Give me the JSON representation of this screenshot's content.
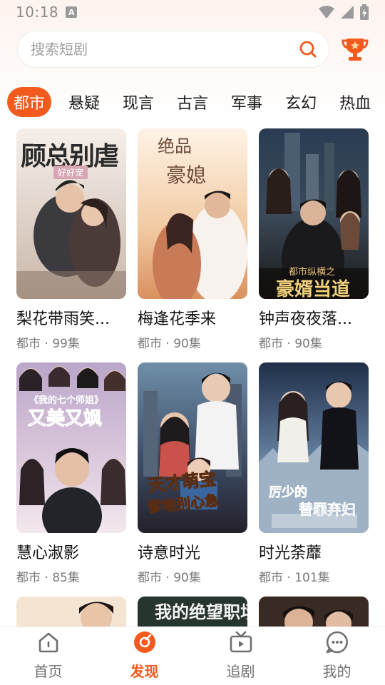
{
  "status_bar": {
    "time": "10:18",
    "badge": "A"
  },
  "search": {
    "placeholder": "搜索短剧"
  },
  "tabs": [
    "都市",
    "悬疑",
    "现言",
    "古言",
    "军事",
    "玄幻",
    "热血"
  ],
  "active_tab": "都市",
  "dramas": [
    {
      "title": "梨花带雨笑...",
      "genre": "都市",
      "episodes": "99集",
      "poster_text": [
        "顾总别虐",
        "好好宠"
      ]
    },
    {
      "title": "梅逢花季来",
      "genre": "都市",
      "episodes": "90集",
      "poster_text": [
        "绝品",
        "豪媳"
      ]
    },
    {
      "title": "钟声夜夜落...",
      "genre": "都市",
      "episodes": "90集",
      "poster_text": [
        "都市纵横之",
        "豪婿当道"
      ]
    },
    {
      "title": "慧心淑影",
      "genre": "都市",
      "episodes": "85集",
      "poster_text": [
        "《我的七个师姐》",
        "又美又飒"
      ]
    },
    {
      "title": "诗意时光",
      "genre": "都市",
      "episodes": "90集",
      "poster_text": [
        "天才萌宝",
        "爹地别心急"
      ]
    },
    {
      "title": "时光荼蘼",
      "genre": "都市",
      "episodes": "101集",
      "poster_text": [
        "厉少的",
        "替罪弃妇"
      ]
    }
  ],
  "meta_separator": " · ",
  "peek_posters": [
    {
      "poster_text": ""
    },
    {
      "poster_text": "我的绝望职场"
    },
    {
      "poster_text": ""
    }
  ],
  "bottom_nav": [
    {
      "label": "首页",
      "icon": "home-icon"
    },
    {
      "label": "发现",
      "icon": "discover-icon"
    },
    {
      "label": "追剧",
      "icon": "tv-icon"
    },
    {
      "label": "我的",
      "icon": "profile-icon"
    }
  ],
  "active_nav": "发现",
  "colors": {
    "accent": "#f25a1e",
    "text": "#1a1a1a",
    "meta": "#7a7a7a"
  }
}
